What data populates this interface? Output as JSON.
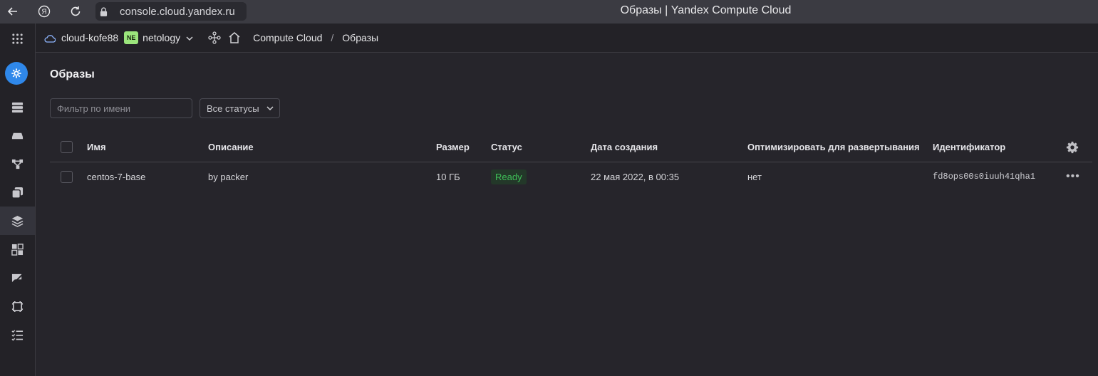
{
  "browser": {
    "url": "console.cloud.yandex.ru",
    "window_title": "Образы | Yandex Compute Cloud"
  },
  "header": {
    "cloud_name": "cloud-kofe88",
    "folder_badge": "NE",
    "folder_name": "netology",
    "breadcrumb": [
      "Compute Cloud",
      "Образы"
    ],
    "breadcrumb_separator": "/"
  },
  "rail": {
    "items": [
      "logo-icon",
      "servers-icon",
      "disks-icon",
      "placement-groups-icon",
      "snapshots-icon",
      "images-icon",
      "instance-groups-icon",
      "gpu-clusters-icon",
      "file-storage-icon",
      "operations-icon"
    ],
    "active": "images-icon"
  },
  "main": {
    "title": "Образы",
    "filter_placeholder": "Фильтр по имени",
    "status_select": "Все статусы"
  },
  "table": {
    "columns": [
      "Имя",
      "Описание",
      "Размер",
      "Статус",
      "Дата создания",
      "Оптимизировать для развертывания",
      "Идентификатор"
    ],
    "rows": [
      {
        "name": "centos-7-base",
        "description": "by packer",
        "size": "10 ГБ",
        "status": "Ready",
        "created": "22 мая 2022, в 00:35",
        "optimize": "нет",
        "id": "fd8ops00s0iuuh41qha1",
        "more": "•••"
      }
    ]
  },
  "colors": {
    "accent": "#2f88ea",
    "status_ready": "#3fbf58",
    "folder_badge_bg": "#9be57c"
  }
}
